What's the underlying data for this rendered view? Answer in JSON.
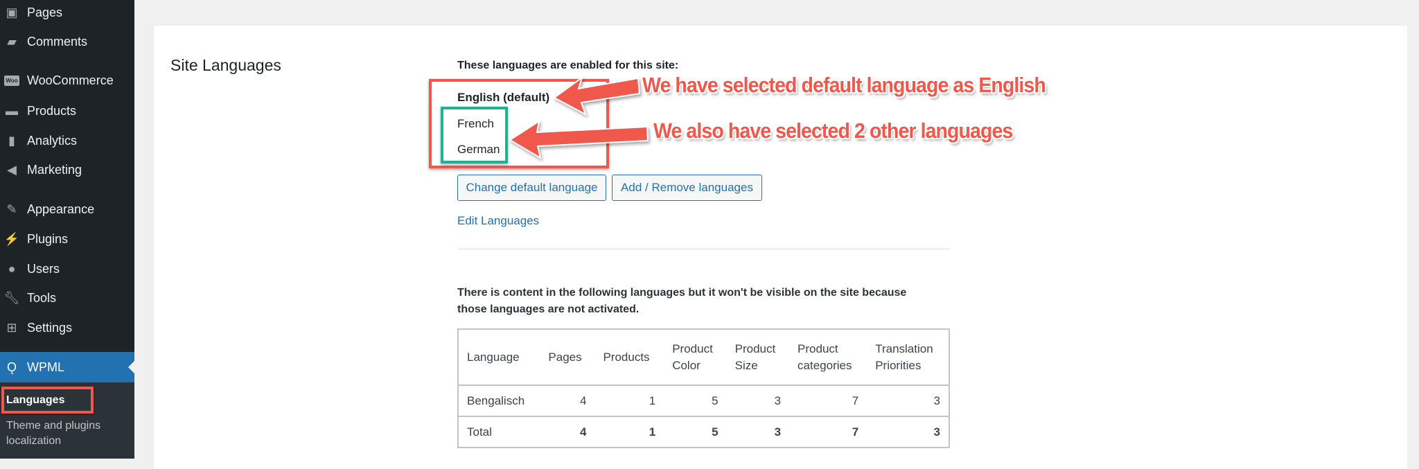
{
  "sidebar": {
    "items": [
      {
        "label": "Pages",
        "icon": "pages-icon"
      },
      {
        "label": "Comments",
        "icon": "comment-icon"
      },
      {
        "label": "WooCommerce",
        "icon": "woo-icon"
      },
      {
        "label": "Products",
        "icon": "archive-icon"
      },
      {
        "label": "Analytics",
        "icon": "bar-chart-icon"
      },
      {
        "label": "Marketing",
        "icon": "megaphone-icon"
      },
      {
        "label": "Appearance",
        "icon": "brush-icon"
      },
      {
        "label": "Plugins",
        "icon": "plug-icon"
      },
      {
        "label": "Users",
        "icon": "user-icon"
      },
      {
        "label": "Tools",
        "icon": "wrench-icon"
      },
      {
        "label": "Settings",
        "icon": "sliders-icon"
      },
      {
        "label": "WPML",
        "icon": "wpml-icon"
      }
    ],
    "woo_icon_text": "Woo",
    "submenu": [
      "Languages",
      "Theme and plugins",
      "localization"
    ]
  },
  "main": {
    "section_title": "Site Languages",
    "enabled_intro": "These languages are enabled for this site:",
    "default_language": "English (default)",
    "other_languages": [
      "French",
      "German"
    ],
    "change_default_button": "Change default language",
    "add_remove_button": "Add / Remove languages",
    "edit_languages_link": "Edit Languages",
    "inactive_notice_1": "There is content in the following languages but it won't be visible on the site because",
    "inactive_notice_2": "those languages are not activated.",
    "table": {
      "headers": [
        [
          "Language",
          ""
        ],
        [
          "Pages",
          ""
        ],
        [
          "Products",
          ""
        ],
        [
          "Product",
          "Color"
        ],
        [
          "Product",
          "Size"
        ],
        [
          "Product",
          "categories"
        ],
        [
          "Translation",
          "Priorities"
        ]
      ],
      "rows": [
        [
          "Bengalisch",
          "4",
          "1",
          "5",
          "3",
          "7",
          "3"
        ]
      ],
      "total": [
        "Total",
        "4",
        "1",
        "5",
        "3",
        "7",
        "3"
      ]
    }
  },
  "annotations": {
    "default_note": "We have selected default language as English",
    "others_note": "We also have selected 2 other languages",
    "red": "#f0584c",
    "green": "#1bb394"
  }
}
